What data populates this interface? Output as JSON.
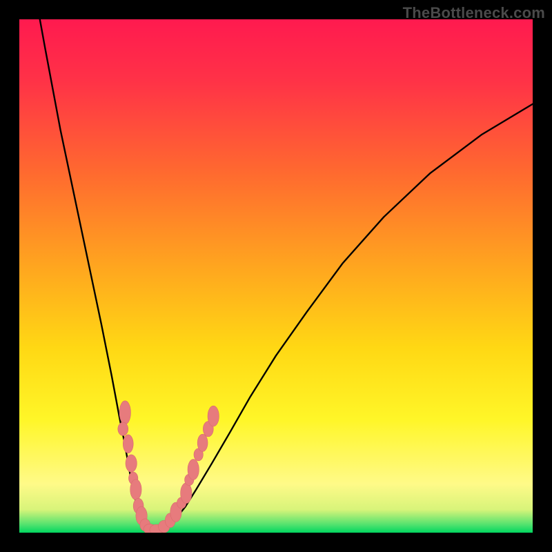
{
  "watermark": "TheBottleneck.com",
  "colors": {
    "frame": "#000000",
    "gradient_stops": [
      {
        "offset": 0.0,
        "color": "#ff1a4f"
      },
      {
        "offset": 0.12,
        "color": "#ff3247"
      },
      {
        "offset": 0.3,
        "color": "#ff6a2f"
      },
      {
        "offset": 0.48,
        "color": "#ffa51f"
      },
      {
        "offset": 0.64,
        "color": "#ffd814"
      },
      {
        "offset": 0.78,
        "color": "#fff628"
      },
      {
        "offset": 0.905,
        "color": "#fffa88"
      },
      {
        "offset": 0.955,
        "color": "#d8f47a"
      },
      {
        "offset": 0.985,
        "color": "#4fe26e"
      },
      {
        "offset": 1.0,
        "color": "#00d65f"
      }
    ],
    "curve": "#000000",
    "marker_fill": "#e77b7d",
    "marker_stroke": "#d96a6c"
  },
  "chart_data": {
    "type": "line",
    "title": "",
    "xlabel": "",
    "ylabel": "",
    "xlim": [
      0,
      100
    ],
    "ylim": [
      0,
      100
    ],
    "series": [
      {
        "name": "left-branch",
        "x": [
          4.0,
          5.0,
          6.5,
          8.0,
          10.0,
          12.0,
          14.0,
          16.0,
          18.0,
          19.5,
          20.5,
          21.3,
          22.0,
          22.7,
          23.3,
          23.8,
          24.2,
          24.5
        ],
        "y": [
          100,
          94.5,
          86.5,
          78.5,
          69.0,
          59.5,
          50.0,
          40.5,
          30.5,
          22.5,
          17.5,
          13.0,
          9.0,
          6.0,
          3.8,
          2.3,
          1.2,
          0.7
        ]
      },
      {
        "name": "valley",
        "x": [
          24.5,
          25.0,
          25.6,
          26.2,
          26.9,
          27.6,
          28.4,
          29.4,
          30.7,
          32.3
        ],
        "y": [
          0.7,
          0.45,
          0.35,
          0.3,
          0.35,
          0.55,
          0.95,
          1.7,
          3.0,
          5.0
        ]
      },
      {
        "name": "right-branch",
        "x": [
          32.3,
          34.5,
          37.5,
          41.0,
          45.0,
          50.0,
          56.0,
          63.0,
          71.0,
          80.0,
          90.0,
          100.0
        ],
        "y": [
          5.0,
          8.5,
          13.5,
          19.5,
          26.5,
          34.5,
          43.0,
          52.5,
          61.5,
          70.0,
          77.5,
          83.5
        ]
      }
    ],
    "markers": [
      {
        "x": 20.6,
        "y": 23.4,
        "rx": 1.1,
        "ry": 2.3,
        "fill": "#e77b7d"
      },
      {
        "x": 20.2,
        "y": 20.2,
        "rx": 1.0,
        "ry": 1.3,
        "fill": "#e77b7d"
      },
      {
        "x": 21.2,
        "y": 17.3,
        "rx": 1.0,
        "ry": 1.8,
        "fill": "#e77b7d"
      },
      {
        "x": 21.8,
        "y": 13.5,
        "rx": 1.1,
        "ry": 1.7,
        "fill": "#e77b7d"
      },
      {
        "x": 22.2,
        "y": 10.6,
        "rx": 0.9,
        "ry": 1.2,
        "fill": "#e77b7d"
      },
      {
        "x": 22.7,
        "y": 8.4,
        "rx": 1.1,
        "ry": 2.0,
        "fill": "#e77b7d"
      },
      {
        "x": 23.2,
        "y": 5.2,
        "rx": 1.0,
        "ry": 1.5,
        "fill": "#e77b7d"
      },
      {
        "x": 23.8,
        "y": 3.3,
        "rx": 1.1,
        "ry": 1.8,
        "fill": "#e77b7d"
      },
      {
        "x": 24.5,
        "y": 1.5,
        "rx": 1.0,
        "ry": 1.2,
        "fill": "#e77b7d"
      },
      {
        "x": 25.4,
        "y": 0.7,
        "rx": 1.2,
        "ry": 1.0,
        "fill": "#e77b7d"
      },
      {
        "x": 26.7,
        "y": 0.6,
        "rx": 1.3,
        "ry": 1.0,
        "fill": "#e77b7d"
      },
      {
        "x": 28.2,
        "y": 1.2,
        "rx": 1.1,
        "ry": 1.2,
        "fill": "#e77b7d"
      },
      {
        "x": 29.4,
        "y": 2.4,
        "rx": 1.0,
        "ry": 1.4,
        "fill": "#e77b7d"
      },
      {
        "x": 30.5,
        "y": 4.0,
        "rx": 1.1,
        "ry": 1.9,
        "fill": "#e77b7d"
      },
      {
        "x": 31.6,
        "y": 5.8,
        "rx": 0.9,
        "ry": 1.1,
        "fill": "#e77b7d"
      },
      {
        "x": 32.5,
        "y": 7.7,
        "rx": 1.1,
        "ry": 2.0,
        "fill": "#e77b7d"
      },
      {
        "x": 33.1,
        "y": 10.3,
        "rx": 0.9,
        "ry": 1.1,
        "fill": "#e77b7d"
      },
      {
        "x": 33.9,
        "y": 12.3,
        "rx": 1.1,
        "ry": 2.0,
        "fill": "#e77b7d"
      },
      {
        "x": 34.9,
        "y": 15.2,
        "rx": 0.9,
        "ry": 1.2,
        "fill": "#e77b7d"
      },
      {
        "x": 35.7,
        "y": 17.5,
        "rx": 1.0,
        "ry": 1.7,
        "fill": "#e77b7d"
      },
      {
        "x": 36.8,
        "y": 20.2,
        "rx": 1.0,
        "ry": 1.5,
        "fill": "#e77b7d"
      },
      {
        "x": 37.8,
        "y": 22.7,
        "rx": 1.1,
        "ry": 2.0,
        "fill": "#e77b7d"
      }
    ]
  }
}
